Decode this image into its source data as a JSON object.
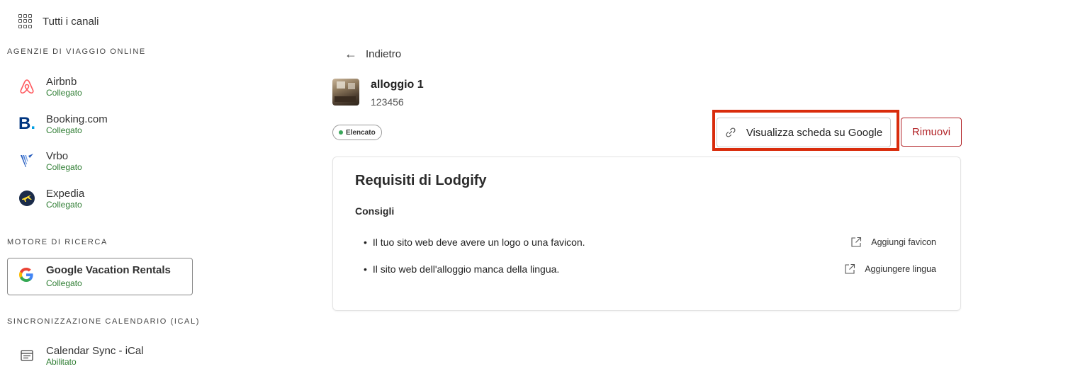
{
  "sidebar": {
    "all_channels": "Tutti i canali",
    "ota_label": "AGENZIE DI VIAGGIO ONLINE",
    "channels": [
      {
        "name": "Airbnb",
        "status": "Collegato",
        "icon": "airbnb-icon"
      },
      {
        "name": "Booking.com",
        "status": "Collegato",
        "icon": "booking-icon"
      },
      {
        "name": "Vrbo",
        "status": "Collegato",
        "icon": "vrbo-icon"
      },
      {
        "name": "Expedia",
        "status": "Collegato",
        "icon": "expedia-icon"
      }
    ],
    "search_label": "MOTORE DI RICERCA",
    "google": {
      "name": "Google Vacation Rentals",
      "status": "Collegato",
      "icon": "google-icon"
    },
    "ical_label": "SINCRONIZZAZIONE CALENDARIO (ICAL)",
    "ical": {
      "name": "Calendar Sync - iCal",
      "status": "Abilitato",
      "icon": "calendar-icon"
    }
  },
  "main": {
    "back_label": "Indietro",
    "property": {
      "name": "alloggio 1",
      "id": "123456"
    },
    "badge": "Elencato",
    "view_google_label": "Visualizza scheda su Google",
    "remove_label": "Rimuovi",
    "requirements": {
      "title": "Requisiti di Lodgify",
      "subtitle": "Consigli",
      "items": [
        {
          "text": "Il tuo sito web deve avere un logo o una favicon.",
          "action": "Aggiungi favicon"
        },
        {
          "text": "Il sito web dell'alloggio manca della lingua.",
          "action": "Aggiungere lingua"
        }
      ]
    }
  },
  "colors": {
    "status_green": "#2e7d32",
    "highlight_red": "#d92c0c",
    "remove_red": "#b3262a",
    "airbnb": "#ff5a5f",
    "booking": "#003580",
    "expedia": "#fddb32"
  }
}
